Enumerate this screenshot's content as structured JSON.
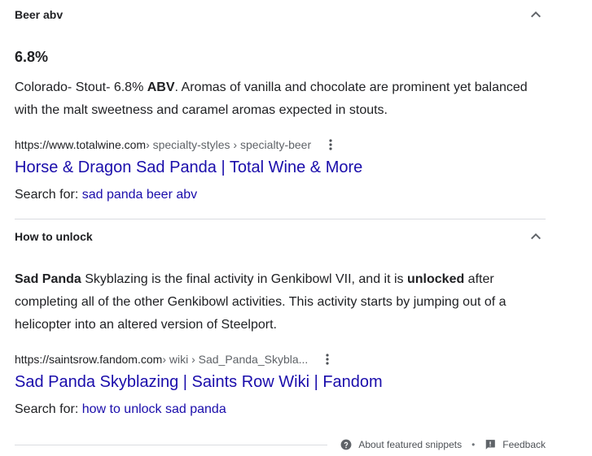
{
  "sections": [
    {
      "title": "Beer abv",
      "answer": "6.8%",
      "snippet": {
        "before": "Colorado- Stout- 6.8% ",
        "bold": "ABV",
        "after": ". Aromas of vanilla and chocolate are prominent yet balanced with the malt sweetness and caramel aromas expected in stouts."
      },
      "cite_url": "https://www.totalwine.com",
      "cite_path": " › specialty-styles › specialty-beer",
      "link_title": "Horse & Dragon Sad Panda | Total Wine & More",
      "search_for_label": "Search for: ",
      "search_for_query": "sad panda beer abv"
    },
    {
      "title": "How to unlock",
      "snippet": {
        "bold1": "Sad Panda",
        "mid1": " Skyblazing is the final activity in Genkibowl VII, and it is ",
        "bold2": "unlocked",
        "after": " after completing all of the other Genkibowl activities. This activity starts by jumping out of a helicopter into an altered version of Steelport."
      },
      "cite_url": "https://saintsrow.fandom.com",
      "cite_path": " › wiki › Sad_Panda_Skybla...",
      "link_title": "Sad Panda Skyblazing | Saints Row Wiki | Fandom",
      "search_for_label": "Search for: ",
      "search_for_query": "how to unlock sad panda"
    }
  ],
  "footer": {
    "about_label": "About featured snippets",
    "separator": "•",
    "feedback_label": "Feedback"
  },
  "icons": {
    "chevron": "chevron-up-icon",
    "more": "more-vert-icon",
    "help": "help-circle-icon",
    "feedback": "feedback-icon"
  },
  "colors": {
    "link": "#1a0dab",
    "text": "#202124",
    "muted": "#5f6368",
    "divider": "#dadce0"
  }
}
